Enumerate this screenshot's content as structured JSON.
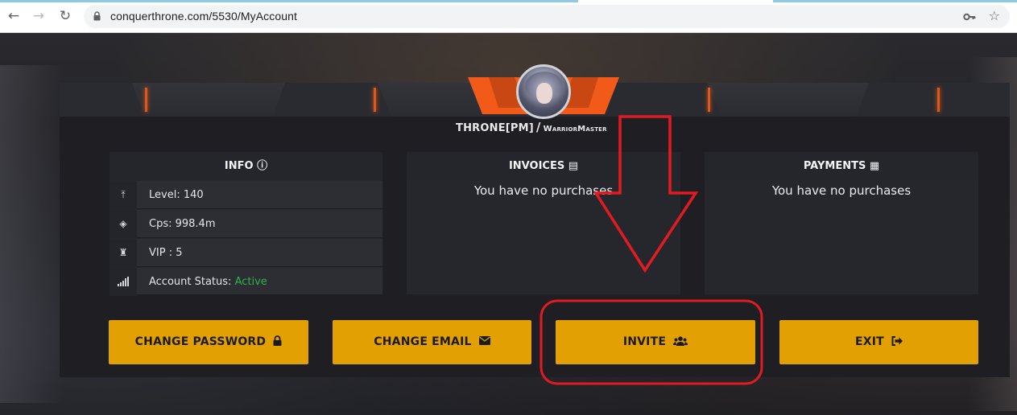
{
  "browser": {
    "back_icon": "←",
    "forward_icon": "→",
    "reload_icon": "↻",
    "url": "conquerthrone.com/5530/MyAccount",
    "star_icon": "☆"
  },
  "account": {
    "guild_name": "THRONE[PM]",
    "separator": "/",
    "player_name": "WarriorMaster"
  },
  "info": {
    "title": "INFO",
    "title_icon": "ⓘ",
    "rows": [
      {
        "icon": "⤒",
        "label": "Level: 140"
      },
      {
        "icon": "◈",
        "label": "Cps: 998.4m"
      },
      {
        "icon": "♜",
        "label": "VIP : 5"
      },
      {
        "icon": "▮",
        "label": "Account Status: ",
        "status": "Active"
      }
    ]
  },
  "invoices": {
    "title": "INVOICES",
    "title_icon": "▤",
    "empty_message": "You have no purchases"
  },
  "payments": {
    "title": "PAYMENTS",
    "title_icon": "▦",
    "empty_message": "You have no purchases"
  },
  "buttons": {
    "change_password": {
      "label": "CHANGE PASSWORD",
      "icon": "🔒"
    },
    "change_email": {
      "label": "CHANGE EMAIL",
      "icon": "✉"
    },
    "invite": {
      "label": "INVITE",
      "icon": "👥"
    },
    "exit": {
      "label": "EXIT",
      "icon": "⇥"
    }
  },
  "colors": {
    "accent_gold": "#e3a003",
    "emblem_orange": "#f15a18",
    "status_green": "#2fb34a",
    "annotation_red": "#e11b22"
  }
}
